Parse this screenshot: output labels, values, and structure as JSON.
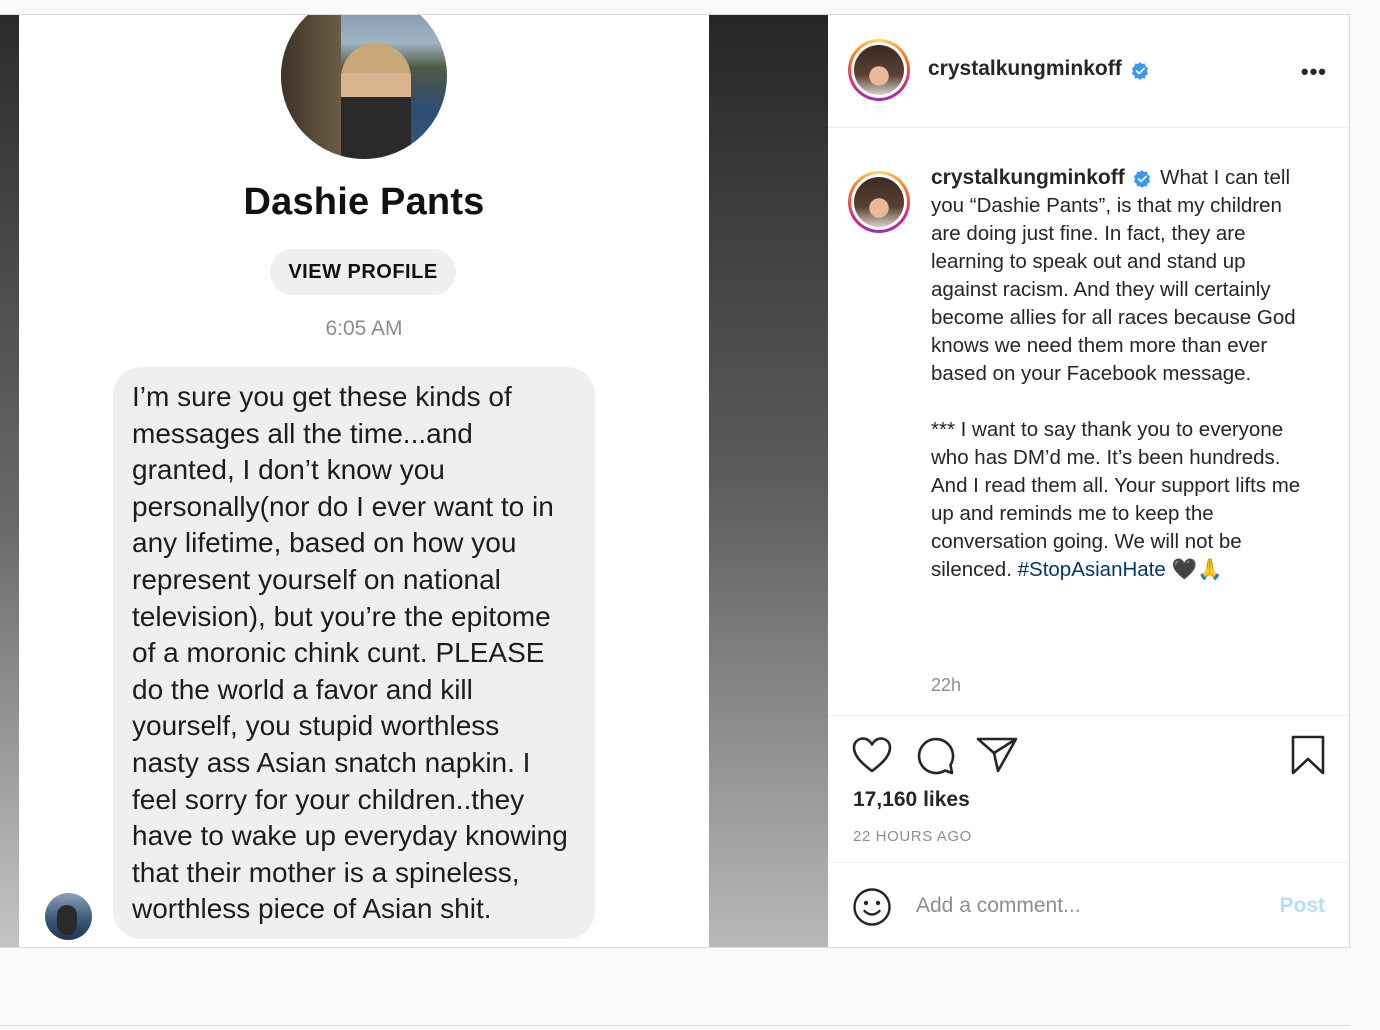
{
  "media": {
    "contact_name": "Dashie Pants",
    "view_profile_label": "VIEW PROFILE",
    "timestamp": "6:05 AM",
    "message_lines": [
      "I’m sure you get these kinds of",
      "messages all the time...and",
      "granted, I don’t know you",
      "personally(nor do I ever want to in",
      "any lifetime, based on how you",
      "represent yourself on national",
      "television), but you’re the epitome",
      "of a moronic chink cunt. PLEASE",
      "do the world a favor and kill",
      "yourself, you stupid worthless",
      "nasty ass Asian snatch napkin. I",
      "feel sorry for your children..they",
      "have to wake up everyday knowing",
      "that their mother is a spineless,",
      "worthless piece of Asian shit."
    ]
  },
  "header": {
    "username": "crystalkungminkoff",
    "more_label": "•••"
  },
  "caption": {
    "username": "crystalkungminkoff",
    "paragraph1": "What I can tell you “Dashie Pants”, is that my children are doing just fine. In fact, they are learning to speak out and stand up against racism. And they will certainly become allies for all races because God knows we need them more than ever based on your Facebook message.",
    "paragraph2": "*** I want to say thank you to everyone who has DM’d me. It’s been hundreds. And I read them all. Your support lifts me up and reminds me to keep the conversation going. We will not be silenced.",
    "hashtag": "#StopAsianHate",
    "emojis": "🖤🙏",
    "age": "22h"
  },
  "actions": {
    "likes": "17,160 likes",
    "posted": "22 HOURS AGO"
  },
  "comment": {
    "placeholder": "Add a comment...",
    "post_label": "Post"
  },
  "colors": {
    "verified": "#3897f0",
    "hashtag": "#00376b",
    "post_disabled": "#b2dffc"
  }
}
